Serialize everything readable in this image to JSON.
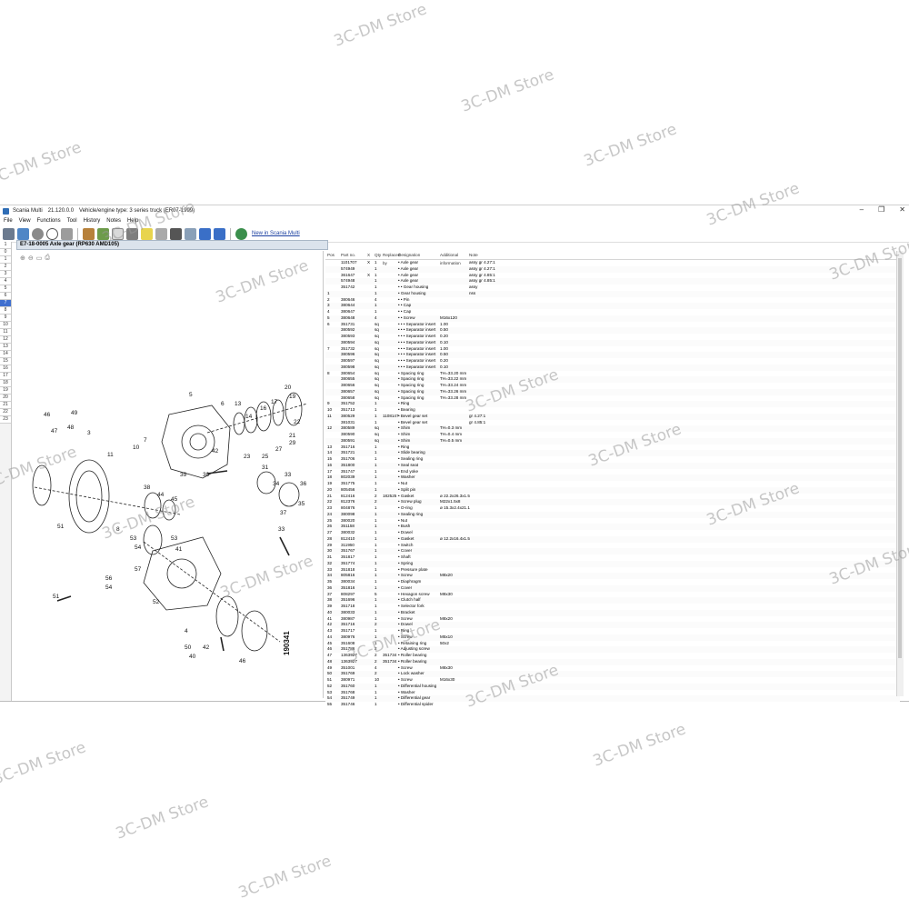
{
  "watermark": "3C-DM Store",
  "window": {
    "app_name": "Scania Multi",
    "version": "21.120.0.0",
    "vehicle": "Vehicle/engine type: 3 series truck (ER07-1999)",
    "controls": [
      "–",
      "❐",
      "✕"
    ]
  },
  "menu": [
    "File",
    "View",
    "Functions",
    "Tool",
    "History",
    "Notes",
    "Help"
  ],
  "toolbar": {
    "link_label": "New in Scania Multi"
  },
  "left_strip": [
    "1",
    "0",
    "1",
    "2",
    "3",
    "4",
    "5",
    "6",
    "7",
    "8",
    "9",
    "10",
    "11",
    "12",
    "13",
    "14",
    "15",
    "16",
    "17",
    "18",
    "19",
    "20",
    "21",
    "22",
    "23"
  ],
  "content_header": "E7-18-0005 Axle gear (RP630 AMD105)",
  "zoom_tools": [
    "⊕",
    "⊖",
    "▭",
    "⎙"
  ],
  "diagram": {
    "drawing_number": "190341",
    "labels": [
      "1",
      "2",
      "3",
      "4",
      "5",
      "6",
      "7",
      "8",
      "9",
      "10",
      "11",
      "12",
      "13",
      "14",
      "15",
      "16",
      "17",
      "18",
      "19",
      "20",
      "21",
      "22",
      "23",
      "24",
      "25",
      "26",
      "27",
      "28",
      "29",
      "30",
      "31",
      "32",
      "33",
      "34",
      "35",
      "36",
      "37",
      "38",
      "39",
      "40",
      "41",
      "42",
      "43",
      "44",
      "45",
      "46",
      "47",
      "48",
      "49",
      "50",
      "51",
      "52",
      "53",
      "54",
      "55",
      "56",
      "57"
    ]
  },
  "table": {
    "headers": [
      "Pos",
      "Part no.",
      "X",
      "Qty",
      "Replaced by",
      "Designation",
      "Additional information",
      "Note"
    ],
    "rows": [
      [
        "",
        "1101707",
        "X",
        "1",
        "",
        "• Axle gear",
        "",
        "assy gr 4.27:1"
      ],
      [
        "",
        "574949",
        "",
        "1",
        "",
        "• Axle gear",
        "",
        "assy gr 4.27:1"
      ],
      [
        "",
        "361647",
        "X",
        "1",
        "",
        "• Axle gear",
        "",
        "assy gr 4.85:1"
      ],
      [
        "",
        "574948",
        "",
        "1",
        "",
        "• Axle gear",
        "",
        "assy gr 4.85:1"
      ],
      [
        "",
        "351742",
        "",
        "1",
        "",
        "• • Gear housing",
        "",
        "assy"
      ],
      [
        "1",
        "",
        "",
        "1",
        "",
        "• Gear housing",
        "",
        "nss"
      ],
      [
        "2",
        "380646",
        "",
        "4",
        "",
        "• • Pin",
        "",
        ""
      ],
      [
        "3",
        "380644",
        "",
        "1",
        "",
        "• • Cap",
        "",
        ""
      ],
      [
        "4",
        "380647",
        "",
        "1",
        "",
        "• • Cap",
        "",
        ""
      ],
      [
        "5",
        "380648",
        "",
        "4",
        "",
        "• • Screw",
        "M16x120",
        ""
      ],
      [
        "6",
        "351731",
        "",
        "sq",
        "",
        "• • • Separator insert",
        "1.00",
        ""
      ],
      [
        "",
        "380592",
        "",
        "sq",
        "",
        "• • • Separator insert",
        "0.50",
        ""
      ],
      [
        "",
        "380593",
        "",
        "sq",
        "",
        "• • • Separator insert",
        "0.20",
        ""
      ],
      [
        "",
        "380594",
        "",
        "sq",
        "",
        "• • • Separator insert",
        "0.10",
        ""
      ],
      [
        "7",
        "351732",
        "",
        "sq",
        "",
        "• • • Separator insert",
        "1.00",
        ""
      ],
      [
        "",
        "380596",
        "",
        "sq",
        "",
        "• • • Separator insert",
        "0.50",
        ""
      ],
      [
        "",
        "380597",
        "",
        "sq",
        "",
        "• • • Separator insert",
        "0.20",
        ""
      ],
      [
        "",
        "380598",
        "",
        "sq",
        "",
        "• • • Separator insert",
        "0.10",
        ""
      ],
      [
        "8",
        "380654",
        "",
        "sq",
        "",
        "• Spacing ring",
        "TH=33.20 mm",
        ""
      ],
      [
        "",
        "380655",
        "",
        "sq",
        "",
        "• Spacing ring",
        "TH=33.22 mm",
        ""
      ],
      [
        "",
        "380656",
        "",
        "sq",
        "",
        "• Spacing ring",
        "TH=33.24 mm",
        ""
      ],
      [
        "",
        "380657",
        "",
        "sq",
        "",
        "• Spacing ring",
        "TH=33.26 mm",
        ""
      ],
      [
        "",
        "380658",
        "",
        "sq",
        "",
        "• Spacing ring",
        "TH=33.28 mm",
        ""
      ],
      [
        "9",
        "351752",
        "",
        "1",
        "",
        "• Ring",
        "",
        ""
      ],
      [
        "10",
        "351713",
        "",
        "1",
        "",
        "• Bearing",
        "",
        ""
      ],
      [
        "11",
        "380529",
        "",
        "1",
        "1108147",
        "• Bevel gear set",
        "",
        "gr 4.27:1"
      ],
      [
        "",
        "381031",
        "",
        "1",
        "",
        "• Bevel gear set",
        "",
        "gr 4.85:1"
      ],
      [
        "12",
        "380589",
        "",
        "sq",
        "",
        "• Shim",
        "TH=0.3 mm",
        ""
      ],
      [
        "",
        "380590",
        "",
        "sq",
        "",
        "• Shim",
        "TH=0.4 mm",
        ""
      ],
      [
        "",
        "380591",
        "",
        "sq",
        "",
        "• Shim",
        "TH=0.5 mm",
        ""
      ],
      [
        "13",
        "351716",
        "",
        "1",
        "",
        "• Ring",
        "",
        ""
      ],
      [
        "14",
        "351721",
        "",
        "1",
        "",
        "• Slide bearing",
        "",
        ""
      ],
      [
        "15",
        "351706",
        "",
        "1",
        "",
        "• Sealing ring",
        "",
        ""
      ],
      [
        "16",
        "351800",
        "",
        "1",
        "",
        "• Seal seat",
        "",
        ""
      ],
      [
        "17",
        "351747",
        "",
        "1",
        "",
        "• End yoke",
        "",
        ""
      ],
      [
        "18",
        "802039",
        "",
        "1",
        "",
        "• Washer",
        "",
        ""
      ],
      [
        "19",
        "351775",
        "",
        "1",
        "",
        "• Nut",
        "",
        ""
      ],
      [
        "20",
        "805456",
        "",
        "1",
        "",
        "• Split pin",
        "",
        ""
      ],
      [
        "21",
        "812416",
        "",
        "2",
        "182525",
        "• Gasket",
        "ø 22.2x26.3x1.5",
        ""
      ],
      [
        "22",
        "812376",
        "",
        "2",
        "",
        "• Screw plug",
        "M22x1.5x8",
        ""
      ],
      [
        "23",
        "804876",
        "",
        "1",
        "",
        "• O-ring",
        "ø 15.3x2.4x21.1",
        ""
      ],
      [
        "24",
        "380098",
        "",
        "1",
        "",
        "• Sealing ring",
        "",
        ""
      ],
      [
        "25",
        "380020",
        "",
        "1",
        "",
        "• Nut",
        "",
        ""
      ],
      [
        "26",
        "351158",
        "",
        "1",
        "",
        "• Bush",
        "",
        ""
      ],
      [
        "27",
        "380032",
        "",
        "1",
        "",
        "• Dowel",
        "",
        ""
      ],
      [
        "28",
        "812410",
        "",
        "1",
        "",
        "• Gasket",
        "ø 12.2x16.4x1.5",
        ""
      ],
      [
        "29",
        "311950",
        "",
        "1",
        "",
        "• Switch",
        "",
        ""
      ],
      [
        "30",
        "351767",
        "",
        "1",
        "",
        "• Cover",
        "",
        ""
      ],
      [
        "31",
        "351817",
        "",
        "1",
        "",
        "• Shaft",
        "",
        ""
      ],
      [
        "32",
        "351774",
        "",
        "1",
        "",
        "• Spring",
        "",
        ""
      ],
      [
        "33",
        "351818",
        "",
        "1",
        "",
        "• Pressure plate",
        "",
        ""
      ],
      [
        "34",
        "805816",
        "",
        "1",
        "",
        "• Screw",
        "M8x20",
        ""
      ],
      [
        "35",
        "380034",
        "",
        "1",
        "",
        "• Diaphragm",
        "",
        ""
      ],
      [
        "36",
        "351816",
        "",
        "1",
        "",
        "• Cover",
        "",
        ""
      ],
      [
        "37",
        "808297",
        "",
        "5",
        "",
        "• Hexagon screw",
        "M8x30",
        ""
      ],
      [
        "38",
        "351696",
        "",
        "1",
        "",
        "• Clutch half",
        "",
        ""
      ],
      [
        "39",
        "351718",
        "",
        "1",
        "",
        "• Selector fork",
        "",
        ""
      ],
      [
        "40",
        "380033",
        "",
        "1",
        "",
        "• Bracket",
        "",
        ""
      ],
      [
        "41",
        "380987",
        "",
        "1",
        "",
        "• Screw",
        "M8x20",
        ""
      ],
      [
        "42",
        "351716",
        "",
        "2",
        "",
        "• Dowel",
        "",
        ""
      ],
      [
        "43",
        "351717",
        "",
        "1",
        "",
        "• Ring",
        "",
        ""
      ],
      [
        "44",
        "380976",
        "",
        "1",
        "",
        "• Screw",
        "M5x10",
        ""
      ],
      [
        "45",
        "351608",
        "",
        "1",
        "",
        "• Retaining ring",
        "50x2",
        ""
      ],
      [
        "46",
        "351786",
        "",
        "2",
        "",
        "• Adjusting screw",
        "",
        ""
      ],
      [
        "47",
        "1363927",
        "",
        "2",
        "351734",
        "• Roller bearing",
        "",
        ""
      ],
      [
        "48",
        "1363927",
        "",
        "2",
        "351734",
        "• Roller bearing",
        "",
        ""
      ],
      [
        "49",
        "351001",
        "",
        "4",
        "",
        "• Screw",
        "M8x30",
        ""
      ],
      [
        "50",
        "351769",
        "",
        "2",
        "",
        "• Lock washer",
        "",
        ""
      ],
      [
        "51",
        "380971",
        "",
        "10",
        "",
        "• Screw",
        "M16x30",
        ""
      ],
      [
        "52",
        "351760",
        "",
        "1",
        "",
        "• Differential housing",
        "",
        ""
      ],
      [
        "53",
        "351768",
        "",
        "1",
        "",
        "• Washer",
        "",
        ""
      ],
      [
        "54",
        "351749",
        "",
        "1",
        "",
        "• Differential gear",
        "",
        ""
      ],
      [
        "55",
        "351746",
        "",
        "1",
        "",
        "• Differential spider",
        "",
        ""
      ]
    ]
  }
}
